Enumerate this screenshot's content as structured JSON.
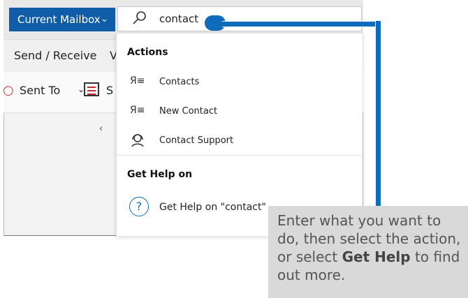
{
  "header": {
    "mailbox_label": "Current Mailbox",
    "search_query": "contact"
  },
  "ribbon": {
    "send_receive": "Send / Receive",
    "view_clipped": "V",
    "sent_to": "Sent To",
    "s_clipped": "S"
  },
  "dropdown": {
    "actions_heading": "Actions",
    "actions": [
      {
        "label": "Contacts",
        "icon": "contacts-icon"
      },
      {
        "label": "New Contact",
        "icon": "contacts-icon"
      },
      {
        "label": "Contact Support",
        "icon": "headset-icon"
      }
    ],
    "help_heading": "Get Help on",
    "help_item": "Get Help on \"contact\""
  },
  "tip": {
    "text_before": "Enter what you want to do, then select the action, or select ",
    "bold1": "Get Help",
    "text_after": " to find out more."
  },
  "colors": {
    "accent": "#0f6cbd",
    "mailbox_bg": "#0f5ca8",
    "tip_bg": "#d9d9d9"
  }
}
